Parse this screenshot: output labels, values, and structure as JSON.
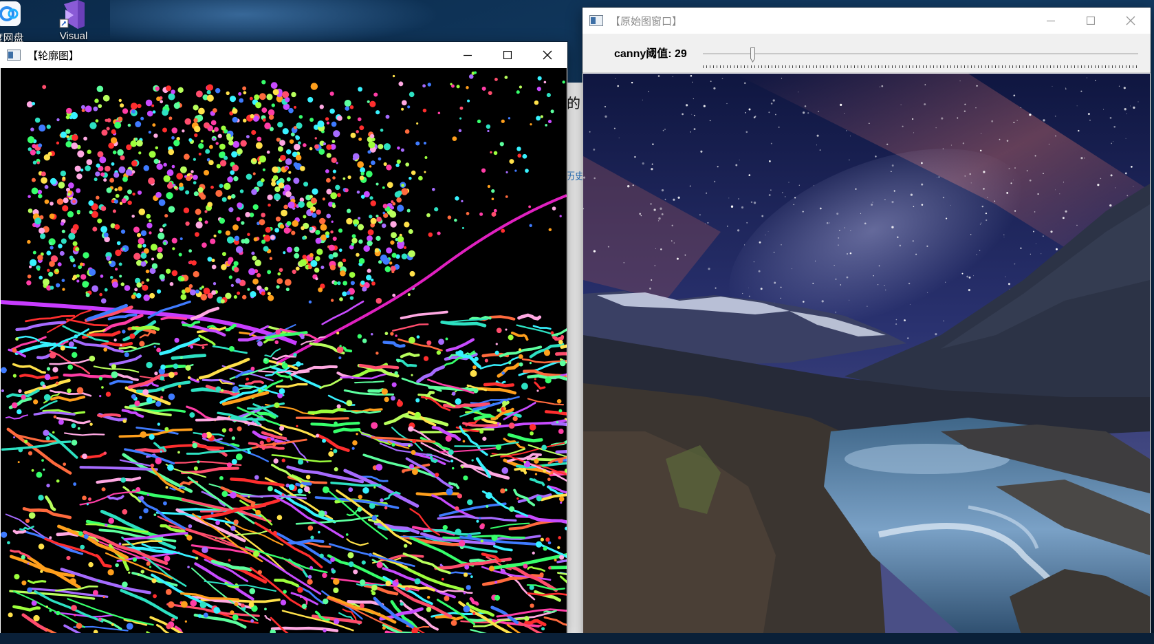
{
  "desktop": {
    "icons": [
      {
        "label": "度网盘",
        "icon": "baidu-netdisk-icon"
      },
      {
        "label": "Visual",
        "icon": "visual-studio-icon"
      }
    ],
    "background_text": {
      "frag1": "的",
      "frag2": "历史"
    }
  },
  "contour_window": {
    "title": "【轮廓图】",
    "icon": "opencv-window-icon",
    "minimize_icon": "minimize-icon",
    "maximize_icon": "maximize-icon",
    "close_icon": "close-icon",
    "state": "active"
  },
  "original_window": {
    "title": "【原始图窗口】",
    "icon": "opencv-window-icon",
    "state": "inactive",
    "trackbar": {
      "label": "canny阈值: 29",
      "value": 29,
      "max": 255
    }
  },
  "colors": {
    "desktop_bg": "#0b2a4a",
    "canvas_black": "#000000",
    "sky_top": "#141c4a",
    "sky_glow": "#7a4a5a",
    "mountain": "#2b2f4a",
    "water": "#6d92b8"
  }
}
